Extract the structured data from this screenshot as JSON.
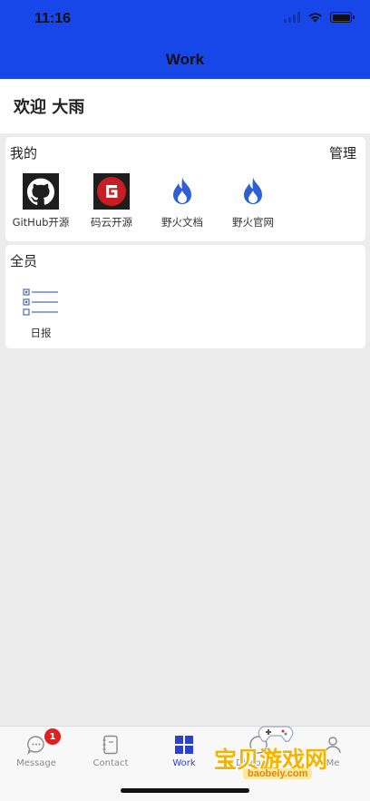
{
  "status_bar": {
    "time": "11:16"
  },
  "nav": {
    "title": "Work"
  },
  "welcome": {
    "text": "欢迎 大雨"
  },
  "mine": {
    "title": "我的",
    "manage_label": "管理",
    "items": [
      {
        "label": "GitHub开源",
        "icon": "github-icon"
      },
      {
        "label": "码云开源",
        "icon": "gitee-icon"
      },
      {
        "label": "野火文档",
        "icon": "fire-icon"
      },
      {
        "label": "野火官网",
        "icon": "fire-icon"
      }
    ]
  },
  "all": {
    "title": "全员",
    "items": [
      {
        "label": "日报",
        "icon": "checklist-icon"
      }
    ]
  },
  "tabs": [
    {
      "label": "Message",
      "icon": "message-icon",
      "badge": "1"
    },
    {
      "label": "Contact",
      "icon": "contact-icon"
    },
    {
      "label": "Work",
      "icon": "work-grid-icon",
      "active": true
    },
    {
      "label": "Discovery",
      "icon": "discovery-icon"
    },
    {
      "label": "Me",
      "icon": "me-icon"
    }
  ],
  "watermark": {
    "text": "宝贝游戏网",
    "url": "baobeiy.com"
  },
  "colors": {
    "brand_blue": "#1747e8",
    "active_tab": "#2a43c9",
    "badge_red": "#e02020",
    "fire_blue": "#2f5fd6"
  }
}
